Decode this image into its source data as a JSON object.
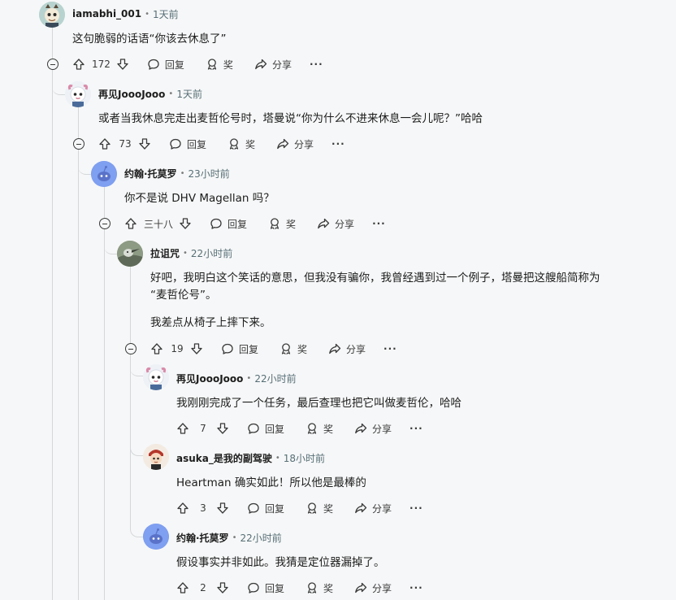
{
  "comments": [
    {
      "user": "iamabhi_001",
      "time": "1天前",
      "body": [
        "这句脆弱的话语“你该去休息了”"
      ],
      "score": "172"
    },
    {
      "user": "再见JoooJooo",
      "time": "1天前",
      "body": [
        "或者当我休息完走出麦哲伦号时，塔曼说“你为什么不进来休息一会儿呢？”哈哈"
      ],
      "score": "73"
    },
    {
      "user": "约翰·托莫罗",
      "time": "23小时前",
      "body": [
        "你不是说 DHV Magellan 吗？"
      ],
      "score": "三十八"
    },
    {
      "user": "拉诅咒",
      "time": "22小时前",
      "body": [
        "好吧，我明白这个笑话的意思，但我没有骗你，我曾经遇到过一个例子，塔曼把这艘船简称为",
        "“麦哲伦号”。",
        "我差点从椅子上摔下来。"
      ],
      "score": "19"
    },
    {
      "user": "再见JoooJooo",
      "time": "22小时前",
      "body": [
        "我刚刚完成了一个任务，最后查理也把它叫做麦哲伦，哈哈"
      ],
      "score": "7"
    },
    {
      "user": "asuka_是我的副驾驶",
      "time": "18小时前",
      "body": [
        "Heartman 确实如此！所以他是最棒的"
      ],
      "score": "3"
    },
    {
      "user": "约翰·托莫罗",
      "time": "22小时前",
      "body": [
        "假设事实并非如此。我猜是定位器漏掉了。"
      ],
      "score": "2"
    }
  ],
  "labels": {
    "reply": "回复",
    "award": "奖",
    "share": "分享",
    "more": "···"
  },
  "icons": {
    "upvote": "arrow-up-icon",
    "downvote": "arrow-down-icon",
    "reply": "speech-bubble-icon",
    "award": "award-ribbon-icon",
    "share": "share-arrow-icon",
    "collapse": "collapse-minus-icon"
  },
  "colors": {
    "background": "#f6f7f8",
    "thread_line": "#d4d7d9",
    "meta_text": "#576f76",
    "avatar_blue": "#7f9ff0"
  }
}
